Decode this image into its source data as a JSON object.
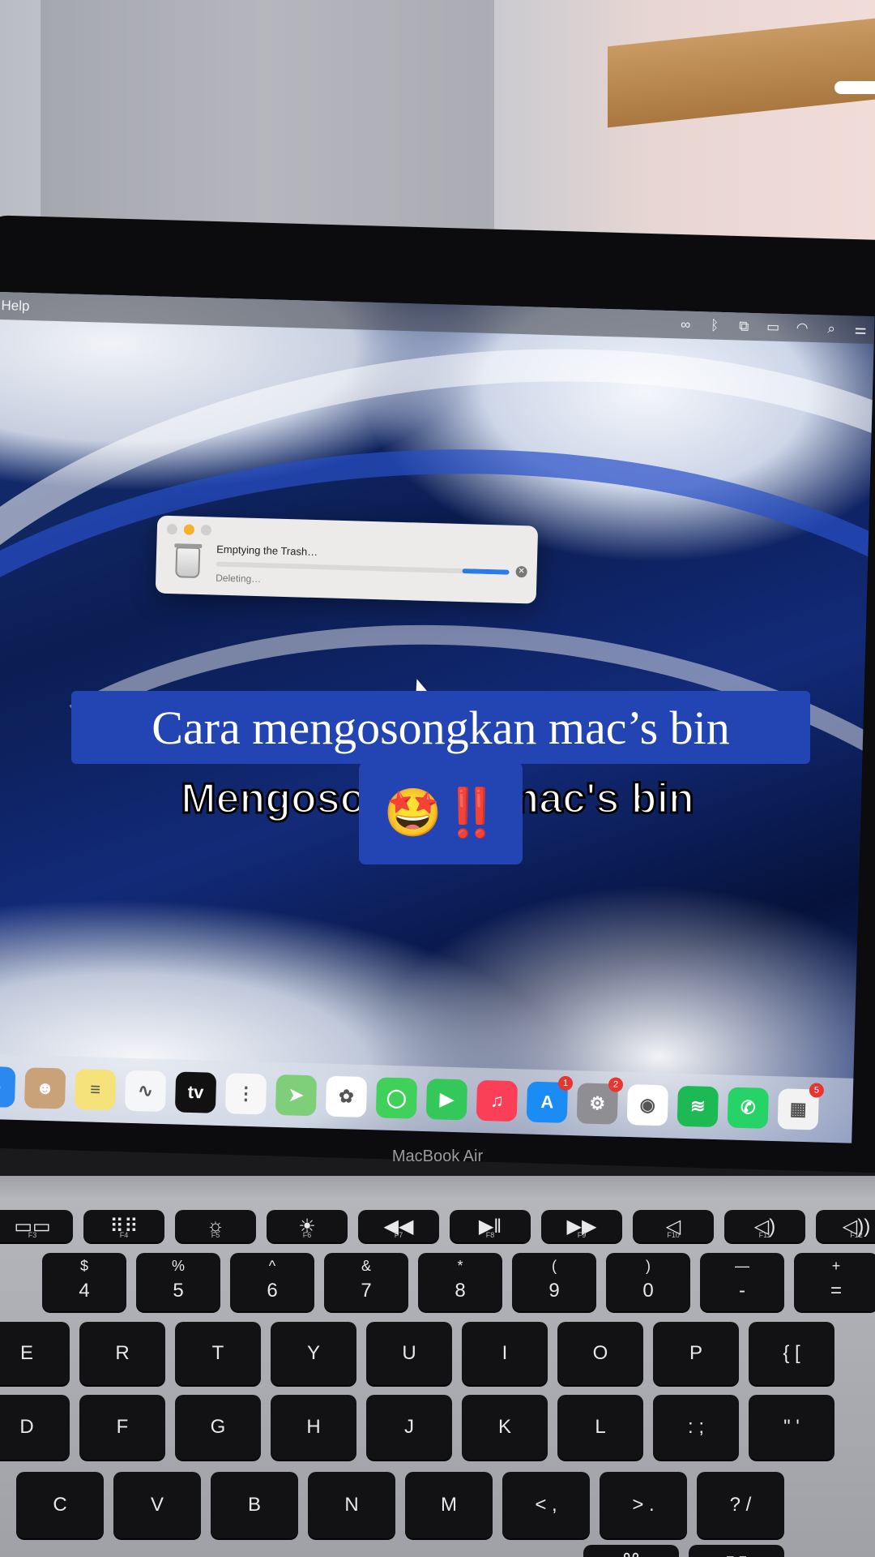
{
  "menubar": {
    "menu_help": "Help",
    "status_icons": [
      "creative-cloud-icon",
      "bluetooth-icon",
      "screen-mirror-icon",
      "battery-icon",
      "wifi-icon",
      "search-icon",
      "control-center-icon"
    ]
  },
  "dialog": {
    "title": "Emptying the Trash…",
    "status": "Deleting…",
    "progress_fraction": 0.16,
    "progress_start_fraction": 0.84
  },
  "dock": {
    "apps": [
      {
        "name": "finder",
        "color": "#2a88f0",
        "glyph": "☺",
        "badge": ""
      },
      {
        "name": "contacts",
        "color": "#c9a27a",
        "glyph": "☻",
        "badge": ""
      },
      {
        "name": "notes",
        "color": "#f6e27a",
        "glyph": "≡",
        "badge": ""
      },
      {
        "name": "freeform",
        "color": "#f4f6f8",
        "glyph": "∿",
        "badge": ""
      },
      {
        "name": "apple-tv",
        "color": "#111111",
        "glyph": "tv",
        "badge": ""
      },
      {
        "name": "reminders",
        "color": "#f7f7f7",
        "glyph": "⋮",
        "badge": ""
      },
      {
        "name": "maps",
        "color": "#7fcf7a",
        "glyph": "➤",
        "badge": ""
      },
      {
        "name": "photos",
        "color": "#ffffff",
        "glyph": "✿",
        "badge": ""
      },
      {
        "name": "messages",
        "color": "#3fd159",
        "glyph": "◯",
        "badge": ""
      },
      {
        "name": "facetime",
        "color": "#34c759",
        "glyph": "▶",
        "badge": ""
      },
      {
        "name": "music",
        "color": "#fa3f56",
        "glyph": "♫",
        "badge": ""
      },
      {
        "name": "app-store",
        "color": "#1c8cf5",
        "glyph": "A",
        "badge": "1"
      },
      {
        "name": "system-settings",
        "color": "#8e8e93",
        "glyph": "⚙",
        "badge": "2"
      },
      {
        "name": "chrome",
        "color": "#ffffff",
        "glyph": "◉",
        "badge": ""
      },
      {
        "name": "spotify",
        "color": "#1db954",
        "glyph": "≋",
        "badge": ""
      },
      {
        "name": "whatsapp",
        "color": "#25d366",
        "glyph": "✆",
        "badge": ""
      },
      {
        "name": "microsoft-office",
        "color": "#f2f2f2",
        "glyph": "▦",
        "badge": "5"
      }
    ]
  },
  "bezel_label": "MacBook Air",
  "keyboard": {
    "function_row": [
      {
        "icon": "▭▭",
        "sub": "F3"
      },
      {
        "icon": "⠿⠿",
        "sub": "F4"
      },
      {
        "icon": "☼",
        "sub": "F5"
      },
      {
        "icon": "☀",
        "sub": "F6"
      },
      {
        "icon": "◀◀",
        "sub": "F7"
      },
      {
        "icon": "▶‖",
        "sub": "F8"
      },
      {
        "icon": "▶▶",
        "sub": "F9"
      },
      {
        "icon": "◁",
        "sub": "F10"
      },
      {
        "icon": "◁)",
        "sub": "F11"
      },
      {
        "icon": "◁))",
        "sub": "F12"
      }
    ],
    "number_row": [
      {
        "top": "$",
        "main": "4"
      },
      {
        "top": "%",
        "main": "5"
      },
      {
        "top": "^",
        "main": "6"
      },
      {
        "top": "&",
        "main": "7"
      },
      {
        "top": "*",
        "main": "8"
      },
      {
        "top": "(",
        "main": "9"
      },
      {
        "top": ")",
        "main": "0"
      },
      {
        "top": "—",
        "main": "-"
      },
      {
        "top": "+",
        "main": "="
      }
    ],
    "row_qwerty": [
      "E",
      "R",
      "T",
      "Y",
      "U",
      "I",
      "O",
      "P",
      "{ ["
    ],
    "row_asdf": [
      "D",
      "F",
      "G",
      "H",
      "J",
      "K",
      "L",
      ": ;",
      "\" '"
    ],
    "row_zxcv": [
      "C",
      "V",
      "B",
      "N",
      "M",
      "< ,",
      "> .",
      "? /"
    ],
    "row_bottom": [
      "⌘",
      "⌥"
    ]
  },
  "overlay": {
    "caption": "Cara mengosongkan mac’s bin",
    "ghost_caption": "Mengosongkan mac's bin",
    "emoji": "🤩",
    "exclaim": "‼️"
  }
}
